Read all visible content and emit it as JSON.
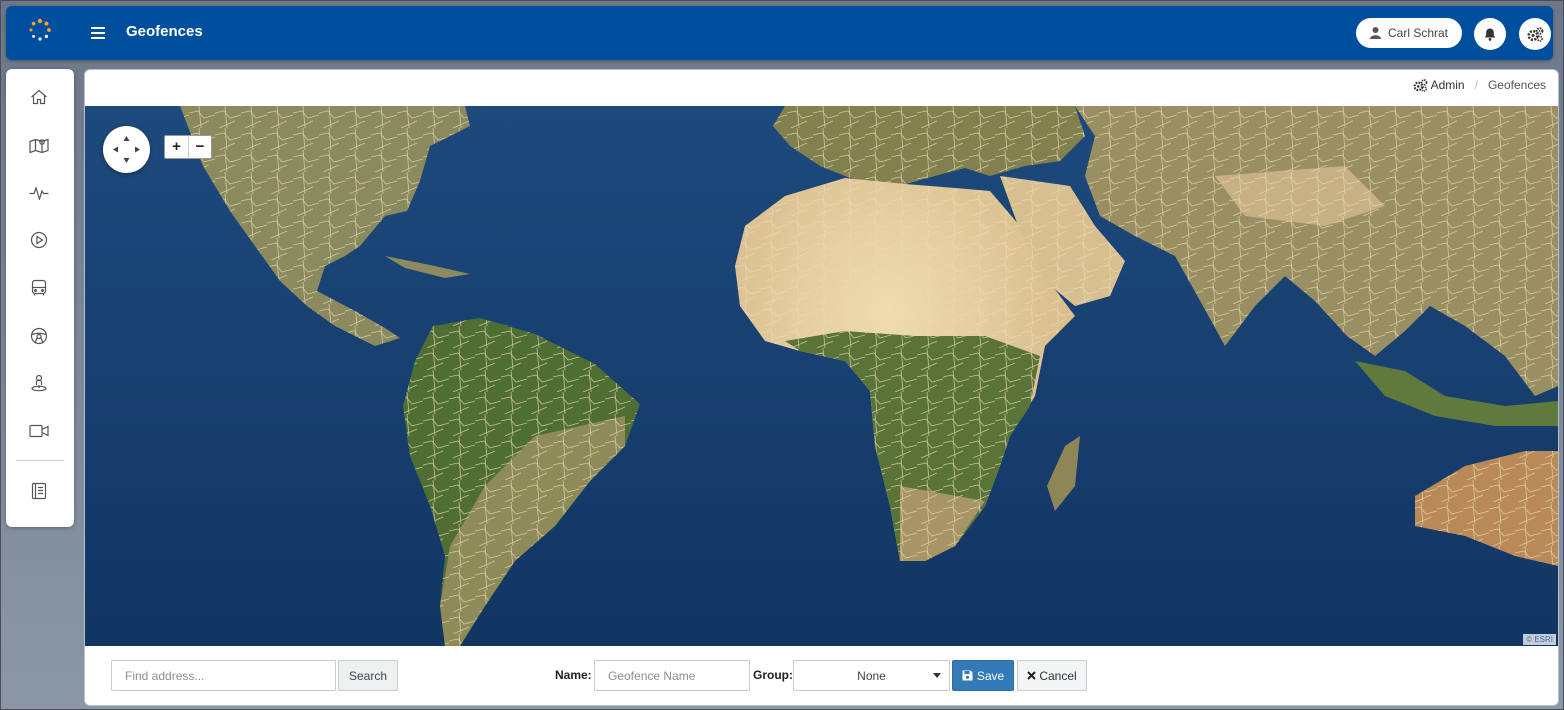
{
  "header": {
    "title": "Geofences",
    "menu_icon": "hamburger-icon",
    "logo_icon": "dotted-circle-logo",
    "user_name": "Carl Schrat",
    "notification_icon": "bell-icon",
    "settings_icon": "gears-icon",
    "brand_color": "#004f9f"
  },
  "sidebar": {
    "items": [
      {
        "icon": "home-icon"
      },
      {
        "icon": "map-icon"
      },
      {
        "icon": "activity-icon"
      },
      {
        "icon": "play-icon"
      },
      {
        "icon": "bus-icon"
      },
      {
        "icon": "steering-wheel-icon"
      },
      {
        "icon": "person-pin-icon"
      },
      {
        "icon": "video-camera-icon"
      },
      {
        "icon": "book-icon"
      }
    ]
  },
  "breadcrumb": {
    "admin": "Admin",
    "separator": "/",
    "current": "Geofences"
  },
  "map": {
    "attribution": "© ESRI",
    "zoom_in": "+",
    "zoom_out": "−"
  },
  "form": {
    "address_placeholder": "Find address...",
    "search_label": "Search",
    "name_label": "Name:",
    "name_placeholder": "Geofence Name",
    "group_label": "Group:",
    "group_value": "None",
    "save_label": "Save",
    "cancel_label": "Cancel",
    "save_color": "#337ab7"
  }
}
